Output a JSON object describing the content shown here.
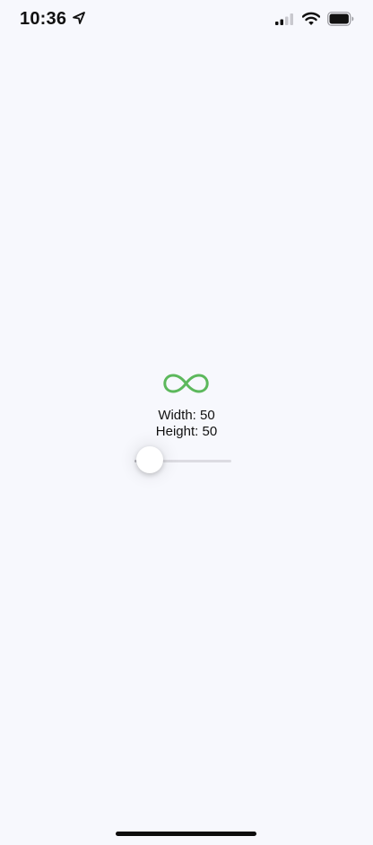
{
  "status_bar": {
    "time": "10:36",
    "icons": [
      "location-arrow-icon",
      "cellular-signal-icon",
      "wifi-icon",
      "battery-icon"
    ]
  },
  "main": {
    "logo_icon": "infinity-icon",
    "logo_color": "#5cb85c",
    "width_text": "Width: 50",
    "height_text": "Height: 50",
    "slider_value": 0
  }
}
